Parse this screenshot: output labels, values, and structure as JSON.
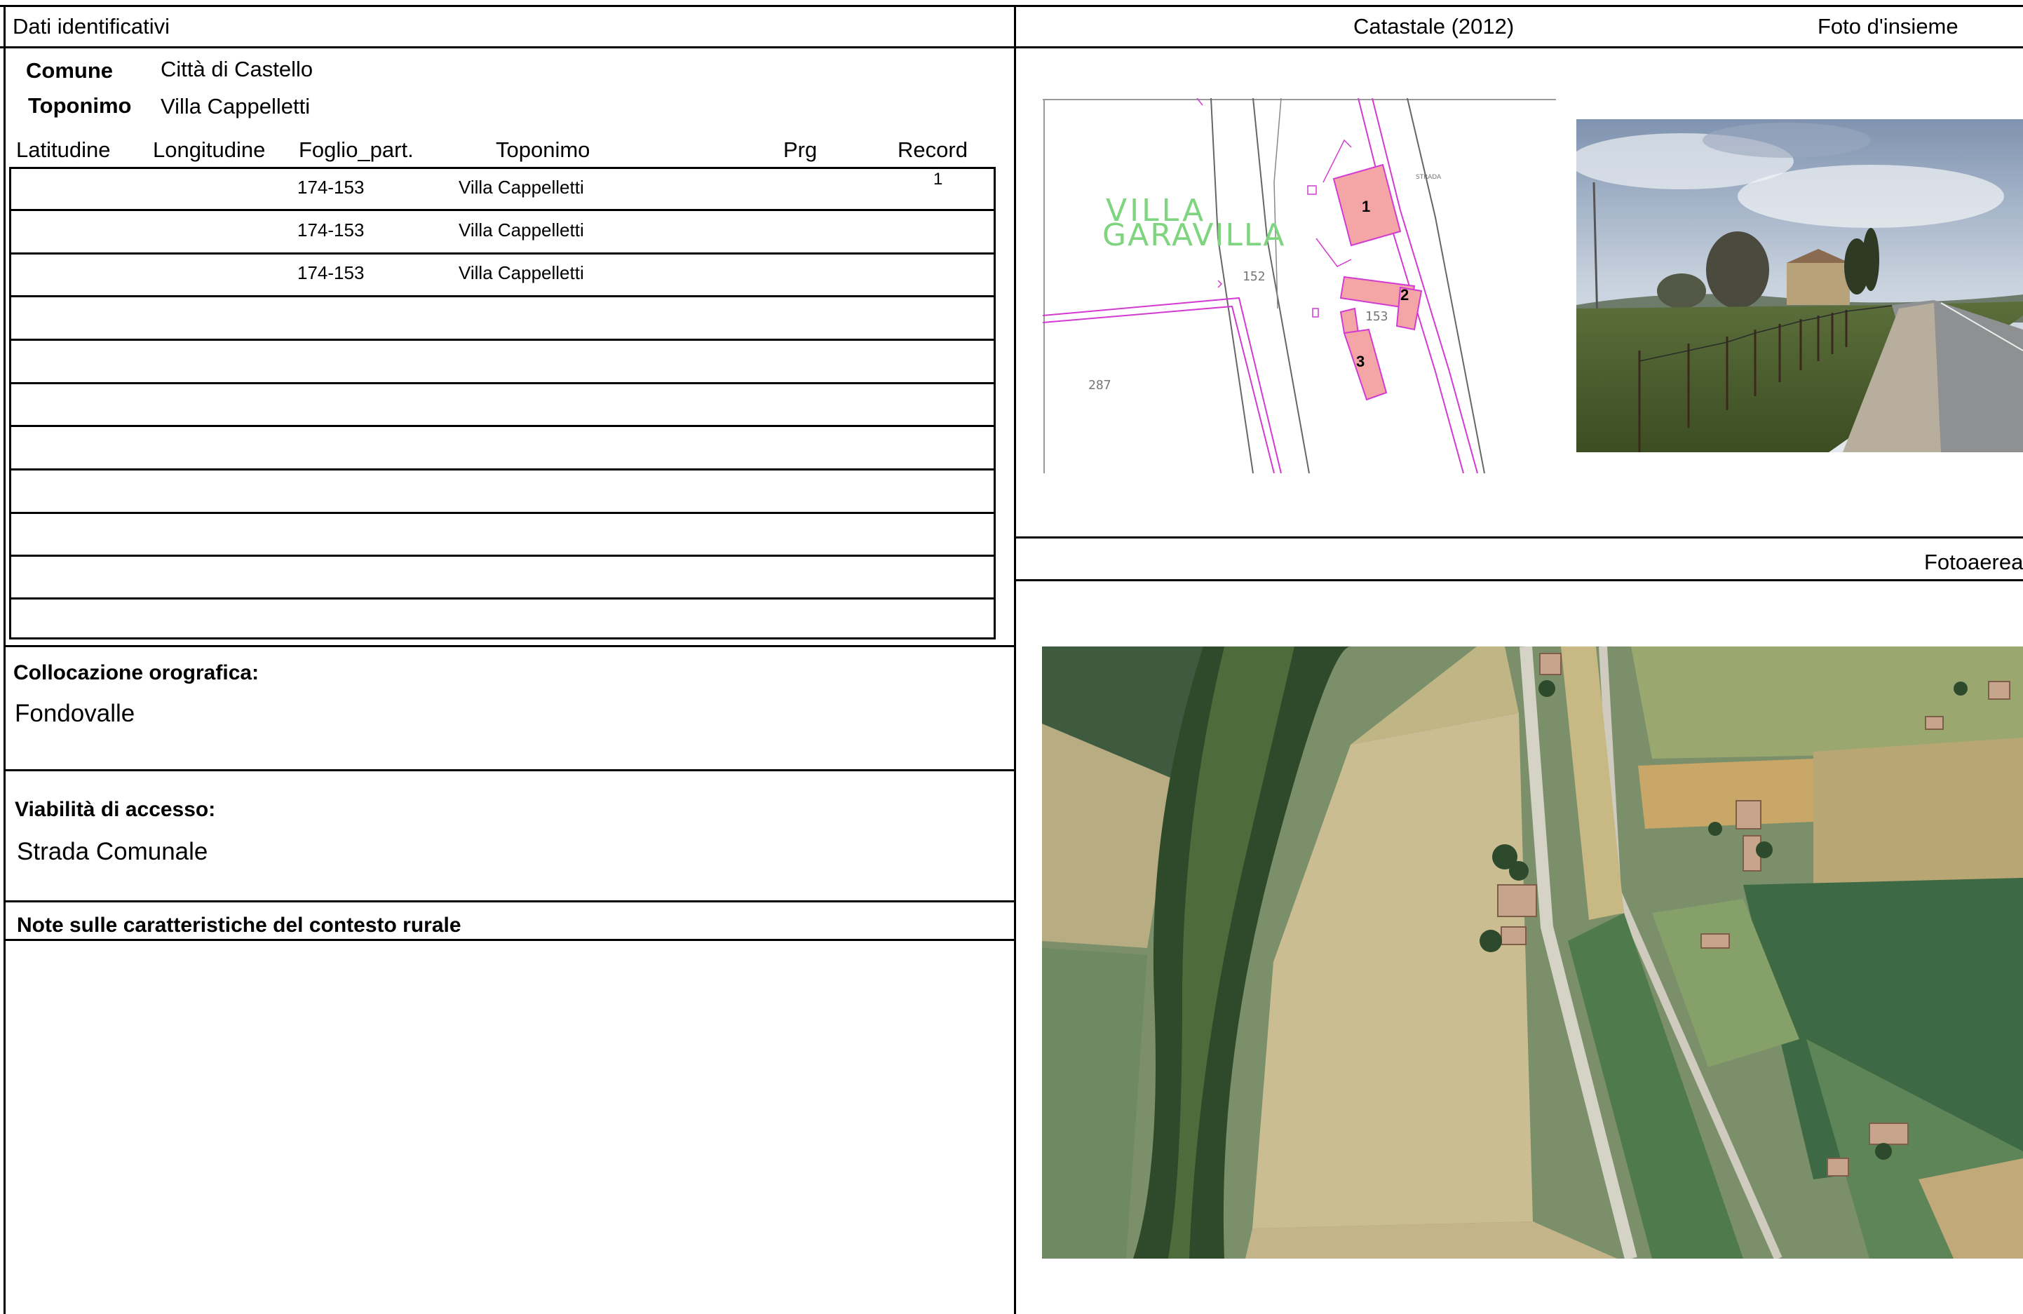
{
  "header": {
    "left_title": "Dati identificativi",
    "catastale_title": "Catastale (2012)",
    "foto_insieme_title": "Foto d'insieme",
    "fotoaerea_title": "Fotoaerea"
  },
  "ident": {
    "comune_label": "Comune",
    "comune_value": "Città di Castello",
    "toponimo_label": "Toponimo",
    "toponimo_value": "Villa Cappelletti"
  },
  "table": {
    "columns": [
      "Latitudine",
      "Longitudine",
      "Foglio_part.",
      "Toponimo",
      "Prg",
      "Record"
    ],
    "rows": [
      {
        "foglio": "174-153",
        "toponimo": "Villa Cappelletti",
        "record": "1"
      },
      {
        "foglio": "174-153",
        "toponimo": "Villa Cappelletti",
        "record": ""
      },
      {
        "foglio": "174-153",
        "toponimo": "Villa Cappelletti",
        "record": ""
      }
    ],
    "empty_rows": 8
  },
  "collocazione": {
    "label": "Collocazione orografica:",
    "value": "Fondovalle"
  },
  "viabilita": {
    "label": "Viabilità di accesso:",
    "value": "Strada Comunale"
  },
  "note": {
    "label": "Note sulle caratteristiche del contesto rurale"
  },
  "cadastral_map": {
    "place_label_1": "VILLA",
    "place_label_2": "GARAVILLA",
    "parcel_152": "152",
    "parcel_153": "153",
    "parcel_287": "287",
    "road_label": "STRADA",
    "building_1": "1",
    "building_2": "2",
    "building_3": "3",
    "colors": {
      "lines": "#d23bd2",
      "buildings": "#f4a6a6",
      "green_text": "#7fd47f"
    }
  }
}
